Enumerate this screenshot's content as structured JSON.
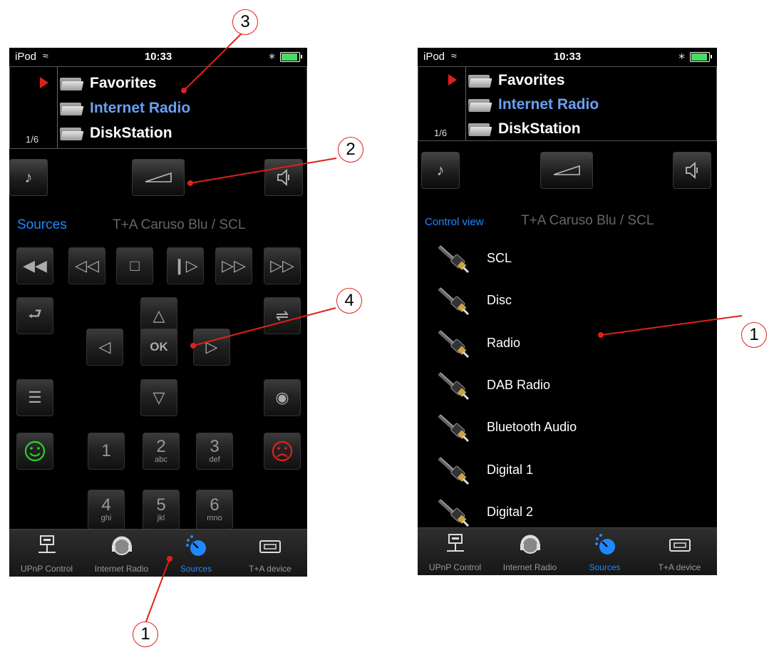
{
  "status": {
    "carrier": "iPod",
    "time": "10:33"
  },
  "browser": {
    "pager": "1/6",
    "items": [
      {
        "label": "Favorites",
        "selected": false
      },
      {
        "label": "Internet Radio",
        "selected": true
      },
      {
        "label": "DiskStation",
        "selected": false
      }
    ]
  },
  "left_screen": {
    "context_title": "Sources",
    "device": "T+A Caruso Blu / SCL",
    "ok_label": "OK",
    "numkeys": [
      {
        "num": "1",
        "sub": ""
      },
      {
        "num": "2",
        "sub": "abc"
      },
      {
        "num": "3",
        "sub": "def"
      },
      {
        "num": "4",
        "sub": "ghi"
      },
      {
        "num": "5",
        "sub": "jkl"
      },
      {
        "num": "6",
        "sub": "mno"
      }
    ]
  },
  "right_screen": {
    "context_title": "Control view",
    "device": "T+A Caruso Blu / SCL",
    "sources": [
      "SCL",
      "Disc",
      "Radio",
      "DAB Radio",
      "Bluetooth Audio",
      "Digital 1",
      "Digital 2"
    ]
  },
  "tabbar": [
    {
      "label": "UPnP Control",
      "icon": "network-icon",
      "active": false
    },
    {
      "label": "Internet Radio",
      "icon": "globe-headphones-icon",
      "active": false
    },
    {
      "label": "Sources",
      "icon": "source-knob-icon",
      "active": true
    },
    {
      "label": "T+A device",
      "icon": "device-icon",
      "active": false
    }
  ],
  "callouts": {
    "c1": "1",
    "c2": "2",
    "c3": "3",
    "c4": "4"
  },
  "colors": {
    "accent": "#1f88ff",
    "selected": "#6aa0f0",
    "callout": "#e0201a"
  }
}
